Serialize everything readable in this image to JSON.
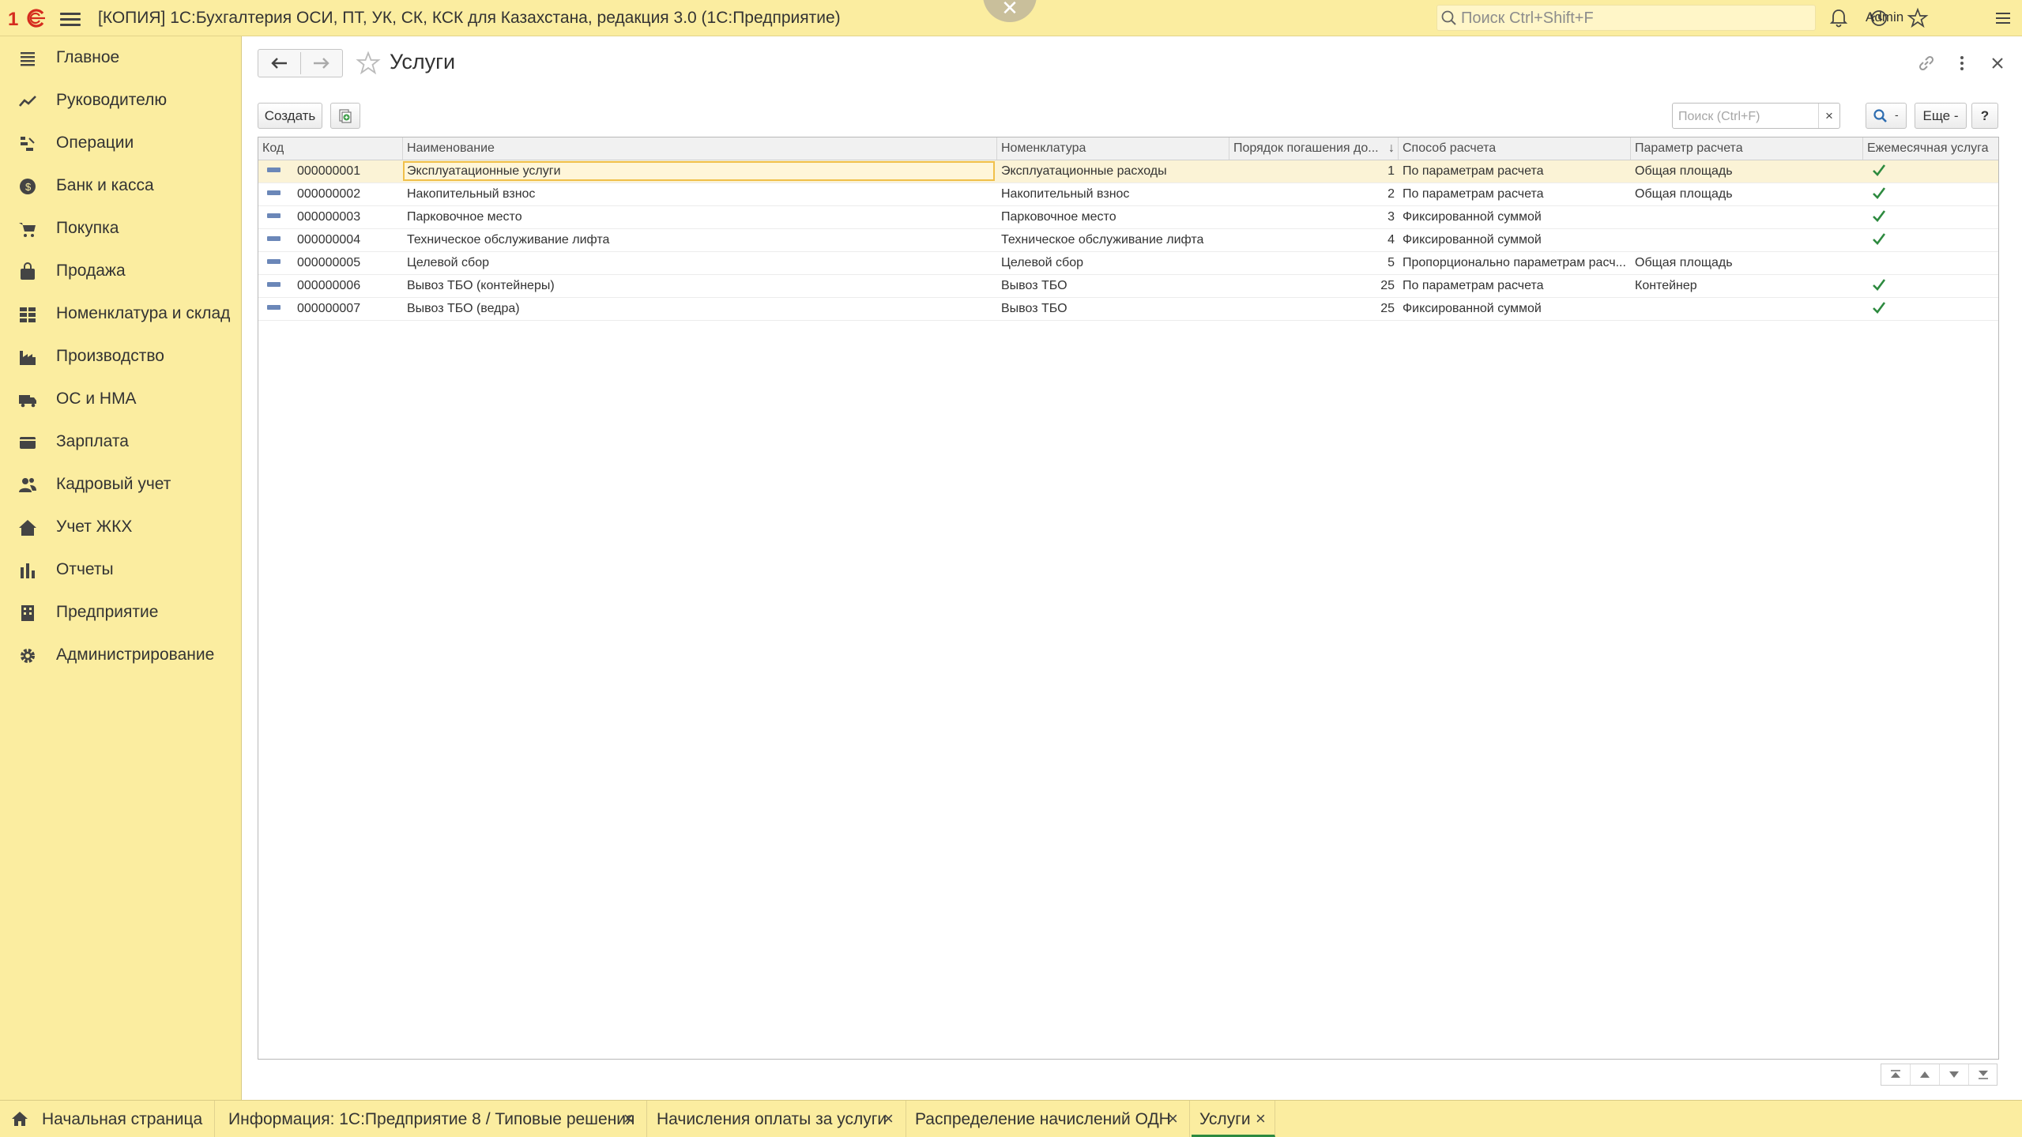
{
  "app": {
    "title": "[КОПИЯ] 1С:Бухгалтерия ОСИ, ПТ, УК, СК, КСК для Казахстана, редакция 3.0  (1С:Предприятие)",
    "logo_text": "1С",
    "search_placeholder": "Поиск Ctrl+Shift+F",
    "user": "Admin"
  },
  "sidebar": {
    "items": [
      {
        "label": "Главное",
        "icon": "menu-list-icon"
      },
      {
        "label": "Руководителю",
        "icon": "trend-chart-icon"
      },
      {
        "label": "Операции",
        "icon": "operations-icon"
      },
      {
        "label": "Банк и касса",
        "icon": "bank-coin-icon"
      },
      {
        "label": "Покупка",
        "icon": "cart-icon"
      },
      {
        "label": "Продажа",
        "icon": "bag-icon"
      },
      {
        "label": "Номенклатура и склад",
        "icon": "grid-blocks-icon"
      },
      {
        "label": "Производство",
        "icon": "factory-icon"
      },
      {
        "label": "ОС и НМА",
        "icon": "truck-icon"
      },
      {
        "label": "Зарплата",
        "icon": "wallet-icon"
      },
      {
        "label": "Кадровый учет",
        "icon": "people-icon"
      },
      {
        "label": "Учет ЖКХ",
        "icon": "house-icon"
      },
      {
        "label": "Отчеты",
        "icon": "bar-chart-icon"
      },
      {
        "label": "Предприятие",
        "icon": "building-icon"
      },
      {
        "label": "Администрирование",
        "icon": "gear-icon"
      }
    ]
  },
  "page": {
    "title": "Услуги",
    "toolbar": {
      "create_label": "Создать",
      "search_placeholder": "Поиск (Ctrl+F)",
      "clear_label": "×",
      "find_dropdown": "-",
      "more_label": "Еще -",
      "help_label": "?"
    }
  },
  "table": {
    "columns": {
      "code": "Код",
      "name": "Наименование",
      "nomenclature": "Номенклатура",
      "order": "Порядок погашения до...",
      "order_sort": "↓",
      "method": "Способ расчета",
      "param": "Параметр расчета",
      "monthly": "Ежемесячная услуга"
    },
    "rows": [
      {
        "code": "000000001",
        "name": "Эксплуатационные услуги",
        "nomenclature": "Эксплуатационные расходы",
        "order": "1",
        "method": "По параметрам расчета",
        "param": "Общая площадь",
        "monthly": true
      },
      {
        "code": "000000002",
        "name": "Накопительный взнос",
        "nomenclature": "Накопительный взнос",
        "order": "2",
        "method": "По параметрам расчета",
        "param": "Общая площадь",
        "monthly": true
      },
      {
        "code": "000000003",
        "name": "Парковочное место",
        "nomenclature": "Парковочное место",
        "order": "3",
        "method": "Фиксированной суммой",
        "param": "",
        "monthly": true
      },
      {
        "code": "000000004",
        "name": "Техническое обслуживание лифта",
        "nomenclature": "Техническое обслуживание лифта",
        "order": "4",
        "method": "Фиксированной суммой",
        "param": "",
        "monthly": true
      },
      {
        "code": "000000005",
        "name": "Целевой сбор",
        "nomenclature": "Целевой сбор",
        "order": "5",
        "method": "Пропорционально параметрам расч...",
        "param": "Общая площадь",
        "monthly": false
      },
      {
        "code": "000000006",
        "name": "Вывоз ТБО (контейнеры)",
        "nomenclature": "Вывоз ТБО",
        "order": "25",
        "method": "По параметрам расчета",
        "param": "Контейнер",
        "monthly": true
      },
      {
        "code": "000000007",
        "name": "Вывоз ТБО (ведра)",
        "nomenclature": "Вывоз ТБО",
        "order": "25",
        "method": "Фиксированной суммой",
        "param": "",
        "monthly": true
      }
    ],
    "selected_row": 0
  },
  "tabs": [
    {
      "label": "Начальная страница",
      "closable": false,
      "active": false
    },
    {
      "label": "Информация: 1С:Предприятие 8 / Типовые решения",
      "closable": true,
      "active": false
    },
    {
      "label": "Начисления оплаты за услуги",
      "closable": true,
      "active": false
    },
    {
      "label": "Распределение начислений ОДН",
      "closable": true,
      "active": false
    },
    {
      "label": "Услуги",
      "closable": true,
      "active": true
    }
  ],
  "colors": {
    "panel": "#fbeda0",
    "accent_green": "#2d8a3f",
    "selection": "#fbf3d6",
    "focus_border": "#f0c04a",
    "logo_red": "#d52b1e"
  }
}
